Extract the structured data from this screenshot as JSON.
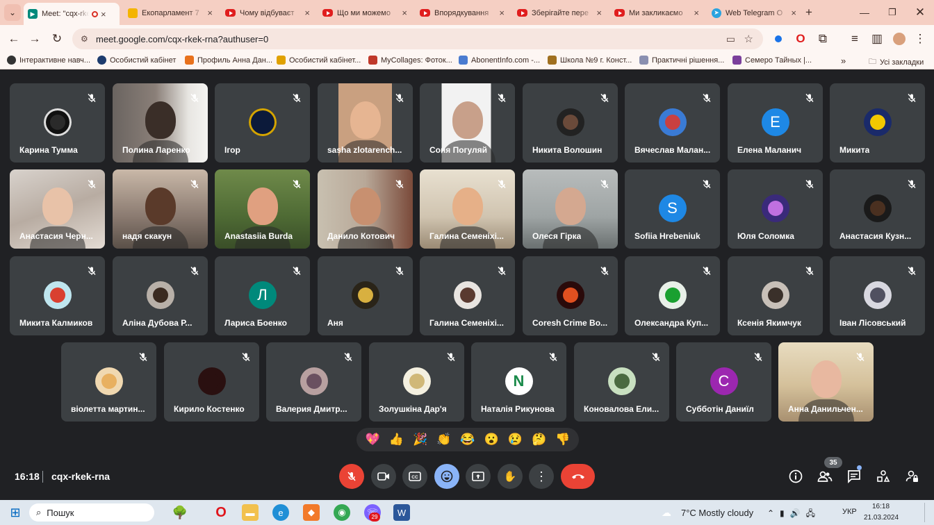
{
  "browser": {
    "tabs": [
      {
        "label": "Meet: \"cqx-rkek-rna\"",
        "icon": "meet-icon"
      },
      {
        "label": "Екопарламент 7",
        "icon": "slides-icon"
      },
      {
        "label": "Чому відбуваєт",
        "icon": "youtube-icon"
      },
      {
        "label": "Що ми можемо",
        "icon": "youtube-icon"
      },
      {
        "label": "Впорядкування",
        "icon": "youtube-icon"
      },
      {
        "label": "Зберігайте пере",
        "icon": "youtube-icon"
      },
      {
        "label": "Ми закликаємо",
        "icon": "youtube-icon"
      },
      {
        "label": "Web Telegram O",
        "icon": "telegram-icon"
      }
    ],
    "url": "meet.google.com/cqx-rkek-rna?authuser=0",
    "bookmarks": [
      "Інтерактивне навч...",
      "Особистий кабінет",
      "Профиль Анна Дан...",
      "Особистий кабінет...",
      "MyCollages: Фоток...",
      "AbonentInfo.com -...",
      "Школа №9 г. Конст...",
      "Практичні рішення...",
      "Семеро Тайных |..."
    ],
    "all_bookmarks": "Усі закладки"
  },
  "participants": [
    "Карина Тумма",
    "Полина Ларенко",
    "Ігор",
    "sasha zlotarench...",
    "Соня Погуляй",
    "Никита Волошин",
    "Вячеслав Малан...",
    "Елена Маланич",
    "Микита",
    "Анастасия Черн...",
    "надя скакун",
    "Anastasiia Burda",
    "Данило Котович",
    "Галина Семеніхі...",
    "Олеся Гірка",
    "Sofiia Hrebeniuk",
    "Юля Соломка",
    "Анастасия Кузн...",
    "Микита Калмиков",
    "Аліна Дубова Р...",
    "Лариса Боенко",
    "Аня",
    "Галина Семеніхі...",
    "Coresh Crime Bo...",
    "Олександра Куп...",
    "Ксенія Якимчук",
    "Іван Лісовський",
    "віолетта мартин...",
    "Кирило Костенко",
    "Валерия Дмитр...",
    "Золушкіна Дар'я",
    "Наталія Рикунова",
    "Коновалова Ели...",
    "Субботін Даниїл",
    "Анна Данильчен..."
  ],
  "avatar_letters": {
    "elena": "E",
    "sofiia": "S",
    "larysa": "Л",
    "nataliia": "N",
    "subbotin": "C"
  },
  "meeting": {
    "time": "16:18",
    "code": "cqx-rkek-rna",
    "participant_count": "35"
  },
  "reactions": [
    "💖",
    "👍",
    "🎉",
    "👏",
    "😂",
    "😮",
    "😢",
    "🤔",
    "👎"
  ],
  "taskbar": {
    "search": "Пошук",
    "weather": "7°C  Mostly cloudy",
    "lang": "УКР",
    "time": "16:18",
    "date": "21.03.2024",
    "chrome_badge": "29"
  },
  "colors": {
    "meet_bg": "#202124",
    "tile_bg": "#3c4043",
    "end_call": "#ea4335",
    "mic_off": "#ea4335",
    "active_control": "#8ab4f8",
    "tab_strip": "#f5cfc3"
  }
}
